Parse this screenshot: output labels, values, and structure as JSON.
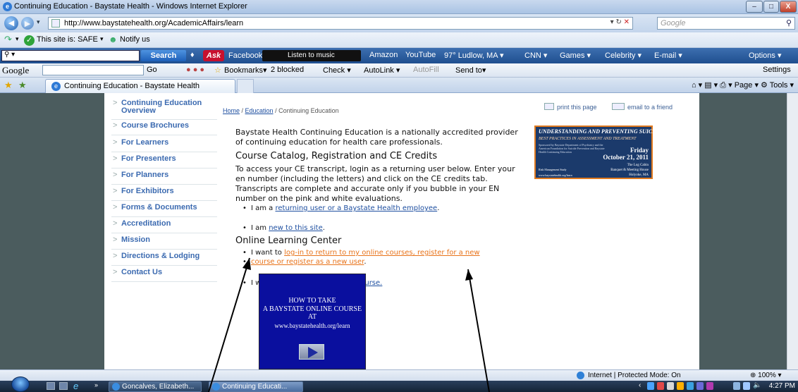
{
  "window": {
    "title": "Continuing Education - Baystate Health - Windows Internet Explorer",
    "minimize": "–",
    "maximize": "□",
    "close": "X"
  },
  "address_bar": {
    "url": "http://www.baystatehealth.org/AcademicAffairs/learn",
    "search_placeholder": "Google"
  },
  "safety_bar": {
    "status": "This site is: SAFE",
    "notify": "Notify us"
  },
  "search_toolbar": {
    "search_label": "Search",
    "ask": "Ask",
    "items": [
      "Facebook ▾",
      "Listen to music",
      "Amazon",
      "YouTube",
      "97° Ludlow, MA ▾",
      "CNN ▾",
      "Games ▾",
      "Celebrity ▾",
      "E-mail ▾",
      "Options ▾"
    ]
  },
  "google_toolbar": {
    "logo": "Google",
    "go": "Go",
    "items": [
      "Bookmarks▾",
      "2 blocked",
      "Check ▾",
      "AutoLink ▾",
      "AutoFill",
      "Send to▾",
      "Settings"
    ]
  },
  "tab": {
    "label": "Continuing Education - Baystate Health",
    "commands": "⌂ ▾  ▤ ▾  ⎙ ▾  Page ▾  ⚙ Tools ▾"
  },
  "left_nav": {
    "items": [
      "Continuing Education Overview",
      "Course Brochures",
      "For Learners",
      "For Presenters",
      "For Planners",
      "For Exhibitors",
      "Forms & Documents",
      "Accreditation",
      "Mission",
      "Directions & Lodging",
      "Contact Us"
    ]
  },
  "breadcrumb": {
    "home": "Home",
    "sep": " / ",
    "education": "Education",
    "current": "Continuing Education"
  },
  "utility": {
    "print": "print this page",
    "email": "email to a friend"
  },
  "main": {
    "intro_1": "Baystate Health Continuing Education is a nationally accredited provider",
    "intro_2": "of continuing education for health care professionals.",
    "heading_1": "Course Catalog, Registration and CE Credits",
    "para_1": "To access your CE transcript, login as a returning user below. Enter your",
    "para_2": "en number (including the letters) and click on the CE credits tab.",
    "para_3": "Transcripts are complete and accurate only if you bubble in your EN",
    "para_4": "number on the pink and white evaluations.",
    "b1_prefix": "I am a ",
    "b1_link": "returning user or a Baystate Health employee",
    "b1_suffix": ".",
    "b2_prefix": "I am ",
    "b2_link": "new to this site",
    "b2_suffix": ".",
    "heading_2": "Online Learning Center",
    "b3_prefix": "I want to ",
    "b3_link_1": "log-in to return to my online courses, register for a new",
    "b3_link_2": "course or register as a new user",
    "b3_suffix": ".",
    "b4_prefix": "I want to ",
    "b4_link": "search for an online course."
  },
  "ad": {
    "line1": "UNDERSTANDING AND PREVENTING SUICIDE:",
    "line2": "BEST PRACTICES IN ASSESSMENT AND TREATMENT",
    "sponsor": "Sponsored by Baystate Department of Psychiatry and the American Foundation for Suicide Prevention and Baystate Health Continuing Education",
    "day": "Friday",
    "date": "October 21, 2011",
    "loc1": "The Log Cabin",
    "loc2": "Banquet & Meeting House",
    "loc3": "Holyoke, MA",
    "study": "Risk Management Study",
    "url": "www.baystatehealth.org/learn"
  },
  "video": {
    "l1": "HOW TO TAKE",
    "l2": "A BAYSTATE ONLINE COURSE AT",
    "l3": "www.baystatehealth.org/learn"
  },
  "status_bar": {
    "zone": "Internet | Protected Mode: On",
    "zoom": "⊕ 100%  ▾"
  },
  "taskbar": {
    "btn1": "Goncalves, Elizabeth...",
    "btn2": "Continuing Educati...",
    "clock": "4:27 PM"
  }
}
